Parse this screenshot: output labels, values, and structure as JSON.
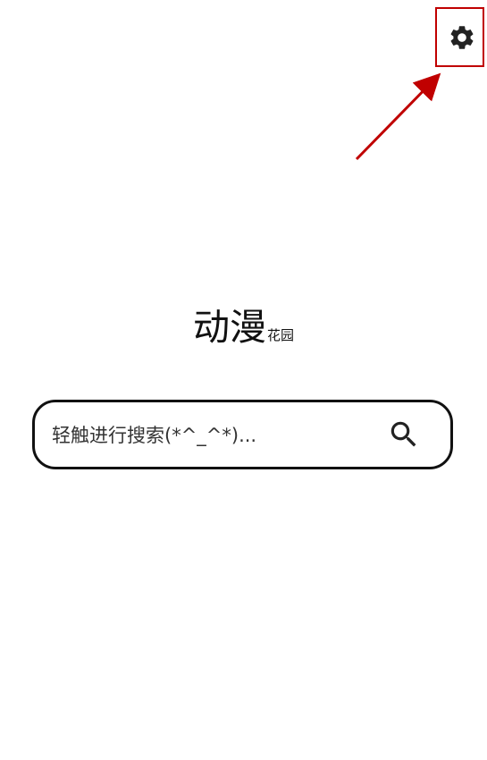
{
  "brand": {
    "title_main": "动漫",
    "title_sub": "花园"
  },
  "search": {
    "placeholder": "轻触进行搜索(*^_^*)..."
  },
  "icons": {
    "settings": "gear-icon",
    "search": "search-icon"
  },
  "colors": {
    "annotation": "#c00000",
    "icon": "#222222",
    "text": "#111111"
  }
}
